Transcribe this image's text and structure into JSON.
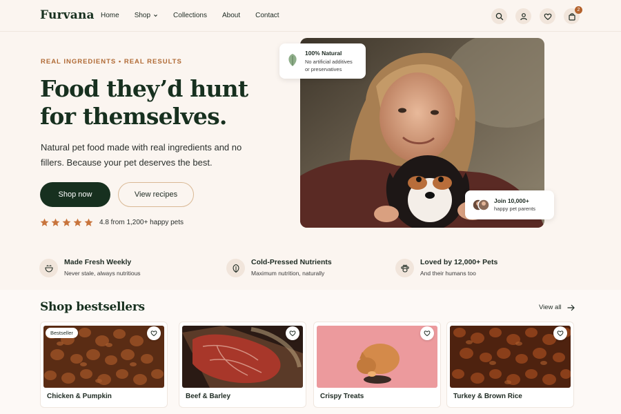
{
  "brand": "Furvana",
  "nav": {
    "items": [
      {
        "label": "Home"
      },
      {
        "label": "Shop"
      },
      {
        "label": "Collections"
      },
      {
        "label": "About"
      },
      {
        "label": "Contact"
      }
    ]
  },
  "header_icons": {
    "search": "search-icon",
    "account": "user-icon",
    "wishlist": "heart-icon",
    "cart": "bag-icon",
    "cart_count": "2"
  },
  "hero": {
    "eyebrow": "REAL INGREDIENTS • REAL RESULTS",
    "title_line1": "Food they’d hunt",
    "title_line2": "for themselves.",
    "subtitle": "Natural pet food made with real ingredients and no fillers. Because your pet deserves the best.",
    "primary_cta": "Shop now",
    "secondary_cta": "View recipes",
    "rating": {
      "stars": 5,
      "text": "4.8 from 1,200+ happy pets"
    }
  },
  "badges": {
    "natural": {
      "title": "100% Natural",
      "line1": "No artificial additives",
      "line2": "or preservatives"
    },
    "join": {
      "title": "Join 10,000+",
      "subtitle": "happy pet parents"
    }
  },
  "features": [
    {
      "icon": "bowl-icon",
      "title": "Made Fresh Weekly",
      "subtitle": "Never stale, always nutritious"
    },
    {
      "icon": "leaf-icon",
      "title": "Cold-Pressed Nutrients",
      "subtitle": "Maximum nutrition, naturally"
    },
    {
      "icon": "paw-icon",
      "title": "Loved by 12,000+ Pets",
      "subtitle": "And their humans too"
    }
  ],
  "bestsellers": {
    "title": "Shop bestsellers",
    "view_all": "View all",
    "products": [
      {
        "name": "Chicken & Pumpkin",
        "tag": "Bestseller"
      },
      {
        "name": "Beef & Barley",
        "tag": ""
      },
      {
        "name": "Crispy Treats",
        "tag": ""
      },
      {
        "name": "Turkey & Brown Rice",
        "tag": ""
      }
    ]
  },
  "colors": {
    "brand_green": "#17301f",
    "accent": "#b06a35",
    "background": "#fbf5f0",
    "badge": "#b4622d"
  }
}
